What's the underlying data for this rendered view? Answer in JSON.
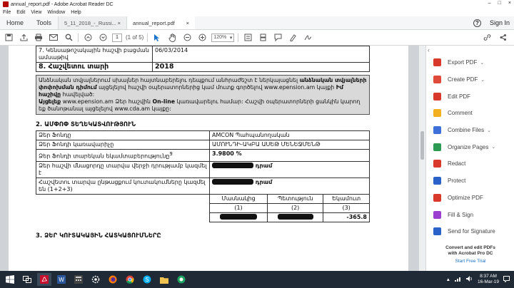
{
  "window": {
    "title": "annual_report.pdf - Adobe Acrobat Reader DC",
    "min": "–",
    "max": "□",
    "close": "×"
  },
  "menu": [
    "File",
    "Edit",
    "View",
    "Window",
    "Help"
  ],
  "tabbar": {
    "home": "Home",
    "tools": "Tools",
    "tabs": [
      {
        "label": "5_11_2018_-_Russi...",
        "close": "×"
      },
      {
        "label": "annual_report.pdf",
        "close": "×"
      }
    ],
    "help": "?",
    "sign_in": "Sign In"
  },
  "toolbar": {
    "page_current": "1",
    "page_total": "(1 of 5)",
    "zoom": "120%"
  },
  "document": {
    "table1": [
      {
        "label": "7. Կենսաթոշակային հաշվի բացման ամսաթիվ",
        "value": "06/03/2014"
      },
      {
        "label": "8. Հաշվետու տարի",
        "value": "2018"
      }
    ],
    "note": {
      "line1": "Անձնական տվյալներում սխալներ հայտնաբերելու դեպքում անհրաժեշտ է ներկայացնել",
      "bold1": "անձնական տվյալների փոփոխման դիմում",
      "line2": "այցելելով հաշվի օպերատորներից կամ մուտք գործելով www.epension.am կայքի",
      "bold2": "Իմ հաշիվը",
      "line3": "հավելված:",
      "bold3": "Այցելեք",
      "line4": "www.epension.am Ձեր հաշվին",
      "bold4": "On-line",
      "line5": "կառավարելու համար: Հաշվի օպերատորների ցանկին կարող եք ծանոթանալ այցելելով www.cda.am կայքը:"
    },
    "section2_title": "2. ԱՄՓՈՓ ՏԵՂԵԿԱՏՎՈՒԹՅՈՒՆ",
    "table2": [
      {
        "label": "Ձեր Ֆոնդը",
        "value": "AMCON Պահպանողական"
      },
      {
        "label": "Ձեր Ֆոնդի կառավարիչը",
        "value": "ԱՄՈՒՆԴԻ-ԱԿԲԱ ԱՍԵԹ ՄԵՆԵՋՄԵՆԹ"
      },
      {
        "label": "Ձեր Ֆոնդի տարեկան եկամտաբերությունը",
        "sup": "9",
        "value": "3.9800 %"
      },
      {
        "label": "Ձեր հաշվի մնացորդը տարվա վերջի դրությամբ կազմել է",
        "unit": "դրամ"
      },
      {
        "label": "Հաշվետու տարվա ընթացքում կուտակումները կազմել են (1+2+3)",
        "unit": "դրամ"
      }
    ],
    "subcols": [
      {
        "name": "Մասնակից",
        "num": "(1)"
      },
      {
        "name": "Պետություն",
        "num": "(2)"
      },
      {
        "name": "Եկամուտ",
        "num": "(3)"
      }
    ],
    "subvalue3": "-365.8",
    "section3_title": "3. ՁԵՐ ԿՈՒՏԱԿԱՅԻՆ ՀԱՏԿԱՑՈՒՄՆԵՐԸ"
  },
  "tools_pane": {
    "items": [
      {
        "label": "Export PDF",
        "chevron": "⌄",
        "color": "#d8392b"
      },
      {
        "label": "Create PDF",
        "chevron": "⌄",
        "color": "#e04a3a"
      },
      {
        "label": "Edit PDF",
        "chevron": "",
        "color": "#d8392b"
      },
      {
        "label": "Comment",
        "chevron": "",
        "color": "#f2b01e"
      },
      {
        "label": "Combine Files",
        "chevron": "⌄",
        "color": "#3f6fd8"
      },
      {
        "label": "Organize Pages",
        "chevron": "⌄",
        "color": "#2c9a52"
      },
      {
        "label": "Redact",
        "chevron": "",
        "color": "#d8392b"
      },
      {
        "label": "Protect",
        "chevron": "",
        "color": "#2a62c9"
      },
      {
        "label": "Optimize PDF",
        "chevron": "",
        "color": "#d8392b"
      },
      {
        "label": "Fill & Sign",
        "chevron": "",
        "color": "#9b3fd1"
      },
      {
        "label": "Send for Signature",
        "chevron": "",
        "color": "#2a62c9"
      }
    ],
    "promo_line1": "Convert and edit PDFs",
    "promo_line2": "with Acrobat Pro DC",
    "promo_trial": "Start Free Trial"
  },
  "taskbar": {
    "time": "8:37 AM",
    "date": "16-Mar-19"
  }
}
